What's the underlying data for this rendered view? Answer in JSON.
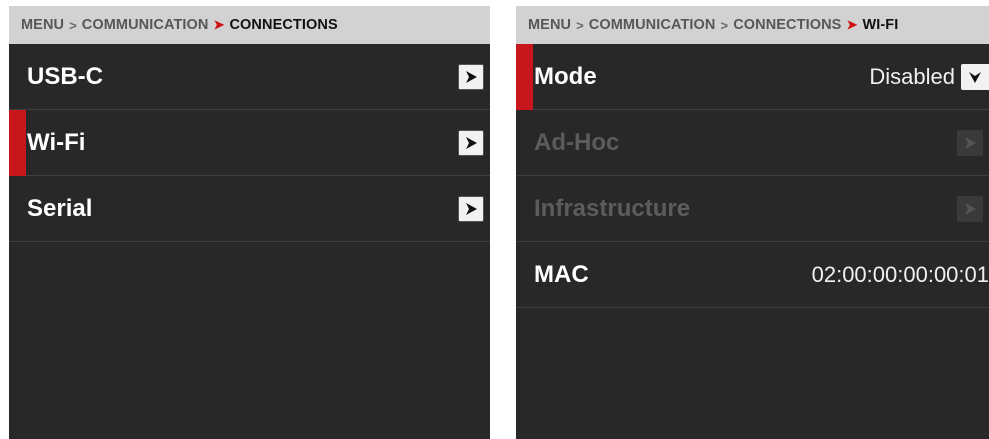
{
  "left_panel": {
    "breadcrumb": [
      "MENU",
      "COMMUNICATION",
      "CONNECTIONS"
    ],
    "items": [
      {
        "label": "USB-C"
      },
      {
        "label": "Wi-Fi"
      },
      {
        "label": "Serial"
      }
    ]
  },
  "right_panel": {
    "breadcrumb": [
      "MENU",
      "COMMUNICATION",
      "CONNECTIONS",
      "WI-FI"
    ],
    "mode": {
      "label": "Mode",
      "value": "Disabled"
    },
    "adhoc": {
      "label": "Ad-Hoc"
    },
    "infrastructure": {
      "label": "Infrastructure"
    },
    "mac": {
      "label": "MAC",
      "value": "02:00:00:00:00:01"
    }
  },
  "colors": {
    "accent": "#c8161d",
    "panel_background": "#282828",
    "breadcrumb_background": "#d2d2d2",
    "disabled_text": "#5c5c5c"
  },
  "icons": {
    "breadcrumb_separator": "chevron-right-icon",
    "row_arrow": "arrow-right-icon",
    "dropdown": "chevron-down-icon"
  }
}
